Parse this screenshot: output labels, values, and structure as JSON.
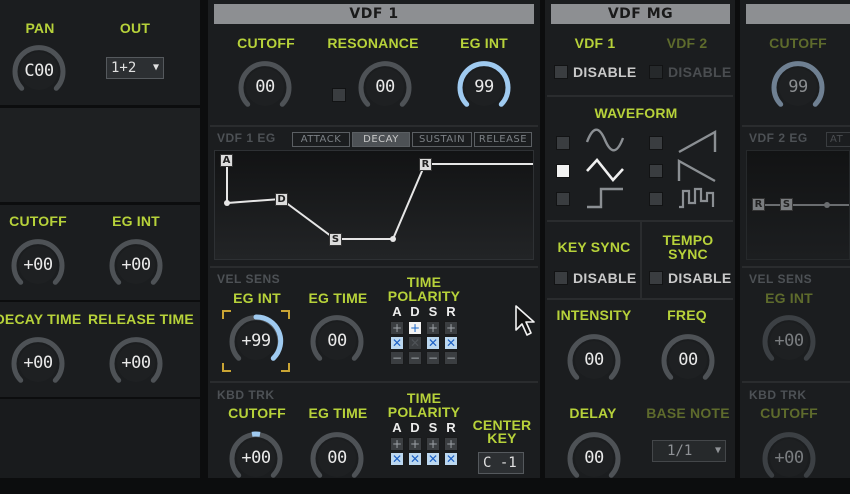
{
  "left": {
    "pan_label": "PAN",
    "pan_value": "C00",
    "out_label": "OUT",
    "out_value": "1+2",
    "cutoff_label": "CUTOFF",
    "cutoff_value": "+00",
    "egint_label": "EG INT",
    "egint_value": "+00",
    "decay_label": "DECAY TIME",
    "decay_value": "+00",
    "release_label": "RELEASE TIME",
    "release_value": "+00"
  },
  "vdf1": {
    "title": "VDF 1",
    "cutoff_label": "CUTOFF",
    "cutoff_value": "00",
    "resonance_label": "RESONANCE",
    "resonance_value": "00",
    "egint_label": "EG INT",
    "egint_value": "99",
    "eg_title": "VDF 1 EG",
    "eg_tabs": [
      "ATTACK",
      "DECAY",
      "SUSTAIN",
      "RELEASE"
    ],
    "eg_selected_tab": "DECAY",
    "eg_nodes": [
      "A",
      "D",
      "S",
      "R"
    ],
    "vel_sens_label": "VEL SENS",
    "vel_egint_label": "EG INT",
    "vel_egint_value": "+99",
    "vel_egtime_label": "EG TIME",
    "vel_egtime_value": "00",
    "time_polarity_label_1": "TIME",
    "time_polarity_label_2": "POLARITY",
    "adsr_letters": [
      "A",
      "D",
      "S",
      "R"
    ],
    "kbd_trk_label": "KBD TRK",
    "kbd_cutoff_label": "CUTOFF",
    "kbd_cutoff_value": "+00",
    "kbd_egtime_label": "EG TIME",
    "kbd_egtime_value": "00",
    "center_key_label_1": "CENTER",
    "center_key_label_2": "KEY",
    "center_key_value": "C -1"
  },
  "vdfmg": {
    "title": "VDF MG",
    "vdf1_label": "VDF 1",
    "vdf2_label": "VDF 2",
    "disable_label": "DISABLE",
    "waveform_label": "WAVEFORM",
    "keysync_label": "KEY SYNC",
    "temposync_label_1": "TEMPO",
    "temposync_label_2": "SYNC",
    "intensity_label": "INTENSITY",
    "intensity_value": "00",
    "freq_label": "FREQ",
    "freq_value": "00",
    "delay_label": "DELAY",
    "delay_value": "00",
    "basenote_label": "BASE NOTE",
    "basenote_value": "1/1"
  },
  "vdf2": {
    "cutoff_label": "CUTOFF",
    "cutoff_value": "99",
    "eg_title": "VDF 2 EG",
    "eg_tab_partial": "AT",
    "vel_sens_label": "VEL SENS",
    "vel_egint_label": "EG INT",
    "vel_egint_value": "+00",
    "kbd_trk_label": "KBD TRK",
    "kbd_cutoff_label": "CUTOFF",
    "kbd_cutoff_value": "+00"
  },
  "colors": {
    "label_green": "#b7d23a",
    "label_green_dim": "#5e6b2c",
    "panel": "#1b1d1f",
    "header": "#8d8f92",
    "knob_accent": "#9fcaf0"
  }
}
